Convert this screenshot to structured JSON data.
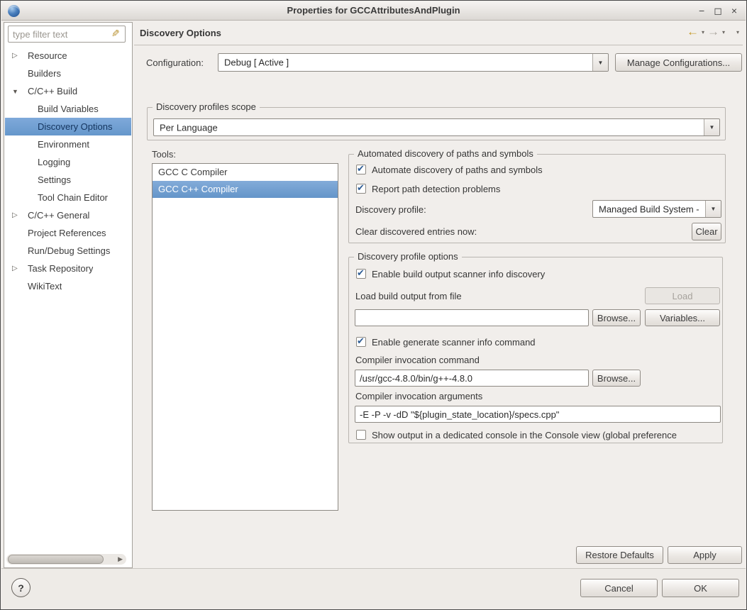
{
  "window": {
    "title": "Properties for GCCAttributesAndPlugin",
    "controls": {
      "minimize": "−",
      "maximize": "◻",
      "close": "×"
    }
  },
  "sidebar": {
    "filter_placeholder": "type filter text",
    "tree": [
      {
        "label": "Resource",
        "indent": 0,
        "arrow": "collapsed"
      },
      {
        "label": "Builders",
        "indent": 0
      },
      {
        "label": "C/C++ Build",
        "indent": 0,
        "arrow": "expanded"
      },
      {
        "label": "Build Variables",
        "indent": 1
      },
      {
        "label": "Discovery Options",
        "indent": 1,
        "selected": true
      },
      {
        "label": "Environment",
        "indent": 1
      },
      {
        "label": "Logging",
        "indent": 1
      },
      {
        "label": "Settings",
        "indent": 1
      },
      {
        "label": "Tool Chain Editor",
        "indent": 1
      },
      {
        "label": "C/C++ General",
        "indent": 0,
        "arrow": "collapsed"
      },
      {
        "label": "Project References",
        "indent": 0
      },
      {
        "label": "Run/Debug Settings",
        "indent": 0
      },
      {
        "label": "Task Repository",
        "indent": 0,
        "arrow": "collapsed"
      },
      {
        "label": "WikiText",
        "indent": 0
      }
    ]
  },
  "header": {
    "title": "Discovery Options"
  },
  "configuration": {
    "label": "Configuration:",
    "value": "Debug [ Active ]",
    "manage_button": "Manage Configurations..."
  },
  "scope": {
    "legend": "Discovery profiles scope",
    "value": "Per Language"
  },
  "tools": {
    "label": "Tools:",
    "items": [
      {
        "label": "GCC C Compiler",
        "selected": false
      },
      {
        "label": "GCC C++ Compiler",
        "selected": true
      }
    ]
  },
  "automated": {
    "legend": "Automated discovery of paths and symbols",
    "automate_checkbox": {
      "label": "Automate discovery of paths and symbols",
      "checked": true
    },
    "report_checkbox": {
      "label": "Report path detection problems",
      "checked": true
    },
    "profile_label": "Discovery profile:",
    "profile_value": "Managed Build System -",
    "clear_label": "Clear discovered entries now:",
    "clear_button": "Clear"
  },
  "profile_options": {
    "legend": "Discovery profile options",
    "scanner_checkbox": {
      "label": "Enable build output scanner info discovery",
      "checked": true
    },
    "load_label": "Load build output from file",
    "load_button": "Load",
    "file_input_value": "",
    "browse_button": "Browse...",
    "variables_button": "Variables...",
    "generate_checkbox": {
      "label": "Enable generate scanner info command",
      "checked": true
    },
    "command_label": "Compiler invocation command",
    "command_value": "/usr/gcc-4.8.0/bin/g++-4.8.0",
    "command_browse_button": "Browse...",
    "arguments_label": "Compiler invocation arguments",
    "arguments_value": "-E -P -v -dD \"${plugin_state_location}/specs.cpp\"",
    "console_checkbox": {
      "label": "Show output in a dedicated console in the Console view (global preference",
      "checked": false
    }
  },
  "actions": {
    "restore_defaults": "Restore Defaults",
    "apply": "Apply",
    "cancel": "Cancel",
    "ok": "OK",
    "help": "?"
  },
  "icons": {
    "back_arrow": "←",
    "forward_arrow": "→",
    "dropdown": "▾",
    "combo_arrow": "▼",
    "scroll_right": "▶",
    "filter_brush": "✎"
  },
  "colors": {
    "selection_blue": "#6d9ece",
    "check_blue": "#2e5c94",
    "back_arrow_gold": "#c59a28"
  }
}
